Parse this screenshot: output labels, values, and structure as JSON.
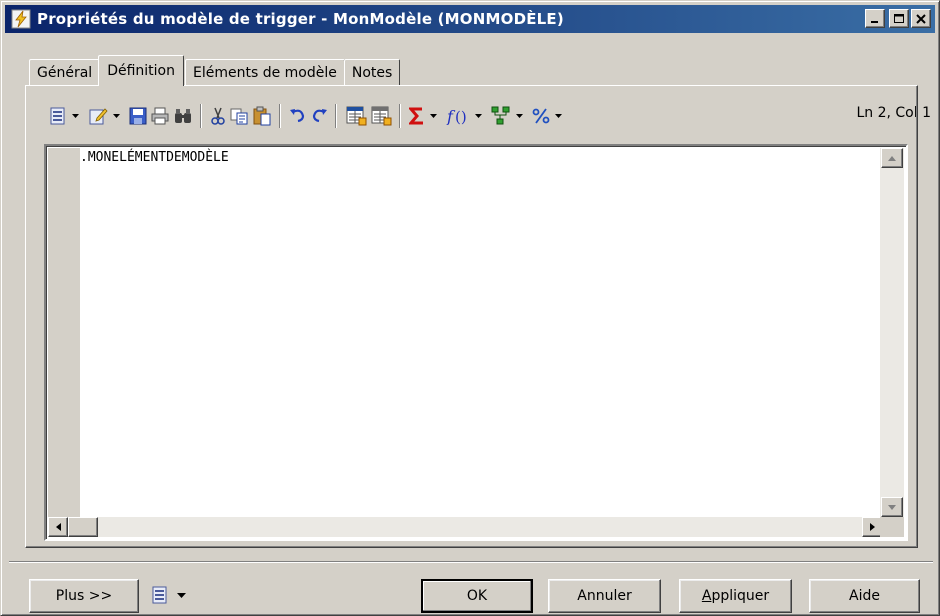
{
  "window": {
    "title": "Propriétés du modèle de trigger - MonModèle (MONMODÈLE)",
    "icon": "trigger-icon",
    "controls": [
      "minimize-icon",
      "maximize-icon",
      "close-icon"
    ]
  },
  "tabs": [
    {
      "label": "Général",
      "active": false
    },
    {
      "label": "Définition",
      "active": true
    },
    {
      "label": "Eléments de modèle",
      "active": false
    },
    {
      "label": "Notes",
      "active": false
    }
  ],
  "toolbar": {
    "items": [
      "properties-icon",
      "edit-icon",
      "save-icon",
      "print-icon",
      "find-icon",
      "cut-icon",
      "copy-icon",
      "paste-icon",
      "undo-icon",
      "redo-icon",
      "insert-template-icon",
      "insert-variable-icon",
      "sigma-icon",
      "function-icon",
      "tree-icon",
      "percent-icon"
    ],
    "position_text": "Ln 2, Col 1"
  },
  "editor": {
    "content": ".MONELÉMENTDEMODÈLE"
  },
  "buttons": {
    "more": "Plus >>",
    "ok": "OK",
    "cancel": "Annuler",
    "apply": "Appliquer",
    "apply_accel": "A",
    "apply_rest": "ppliquer",
    "help": "Aide"
  },
  "colors": {
    "titlebar_start": "#0a246a",
    "titlebar_end": "#3a6ea5",
    "face": "#d4d0c8"
  }
}
